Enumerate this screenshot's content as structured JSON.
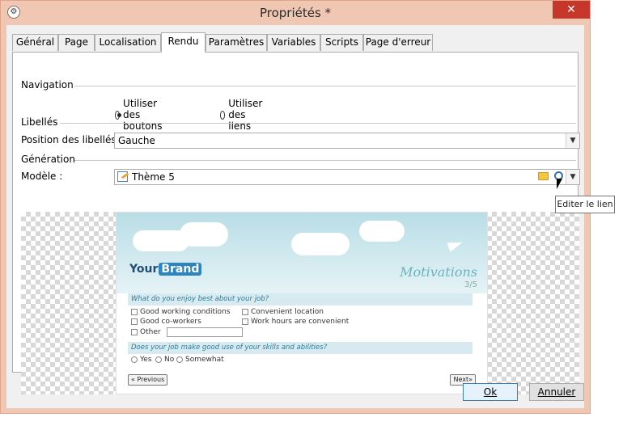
{
  "window": {
    "title": "Propriétés *",
    "close_label": "✕"
  },
  "tabs": [
    {
      "label": "Général"
    },
    {
      "label": "Page"
    },
    {
      "label": "Localisation"
    },
    {
      "label": "Rendu",
      "active": true
    },
    {
      "label": "Paramètres"
    },
    {
      "label": "Variables"
    },
    {
      "label": "Scripts"
    },
    {
      "label": "Page d'erreur"
    }
  ],
  "navigation": {
    "heading": "Navigation",
    "options": [
      {
        "label": "Utiliser des boutons",
        "selected": true
      },
      {
        "label": "Utiliser des liens",
        "selected": false
      }
    ]
  },
  "labels_section": {
    "heading": "Libellés",
    "position_label": "Position des libellés :",
    "position_value": "Gauche"
  },
  "generation": {
    "heading": "Génération",
    "model_label": "Modèle :",
    "model_value": "Thème 5",
    "folder_icon": "folder-icon",
    "edit_link_icon": "edit-link-icon"
  },
  "tooltip": "Editer le lien",
  "preview": {
    "brand_text": "Your",
    "brand_badge": "Brand",
    "title": "Motivations",
    "page": "3/5",
    "q1": "What do you enjoy best about your job?",
    "q1_options": [
      "Good working conditions",
      "Good co-workers",
      "Other",
      "Convenient location",
      "Work hours are convenient"
    ],
    "q2": "Does your job make good use of your skills and abilities?",
    "q2_options": [
      "Yes",
      "No",
      "Somewhat"
    ],
    "prev": "« Previous",
    "next": "Next»"
  },
  "buttons": {
    "ok": "Ok",
    "cancel": "Annuler"
  },
  "colors": {
    "title_bar": "#f0c7b2",
    "close": "#c7362a",
    "accent": "#3c7fb1"
  }
}
